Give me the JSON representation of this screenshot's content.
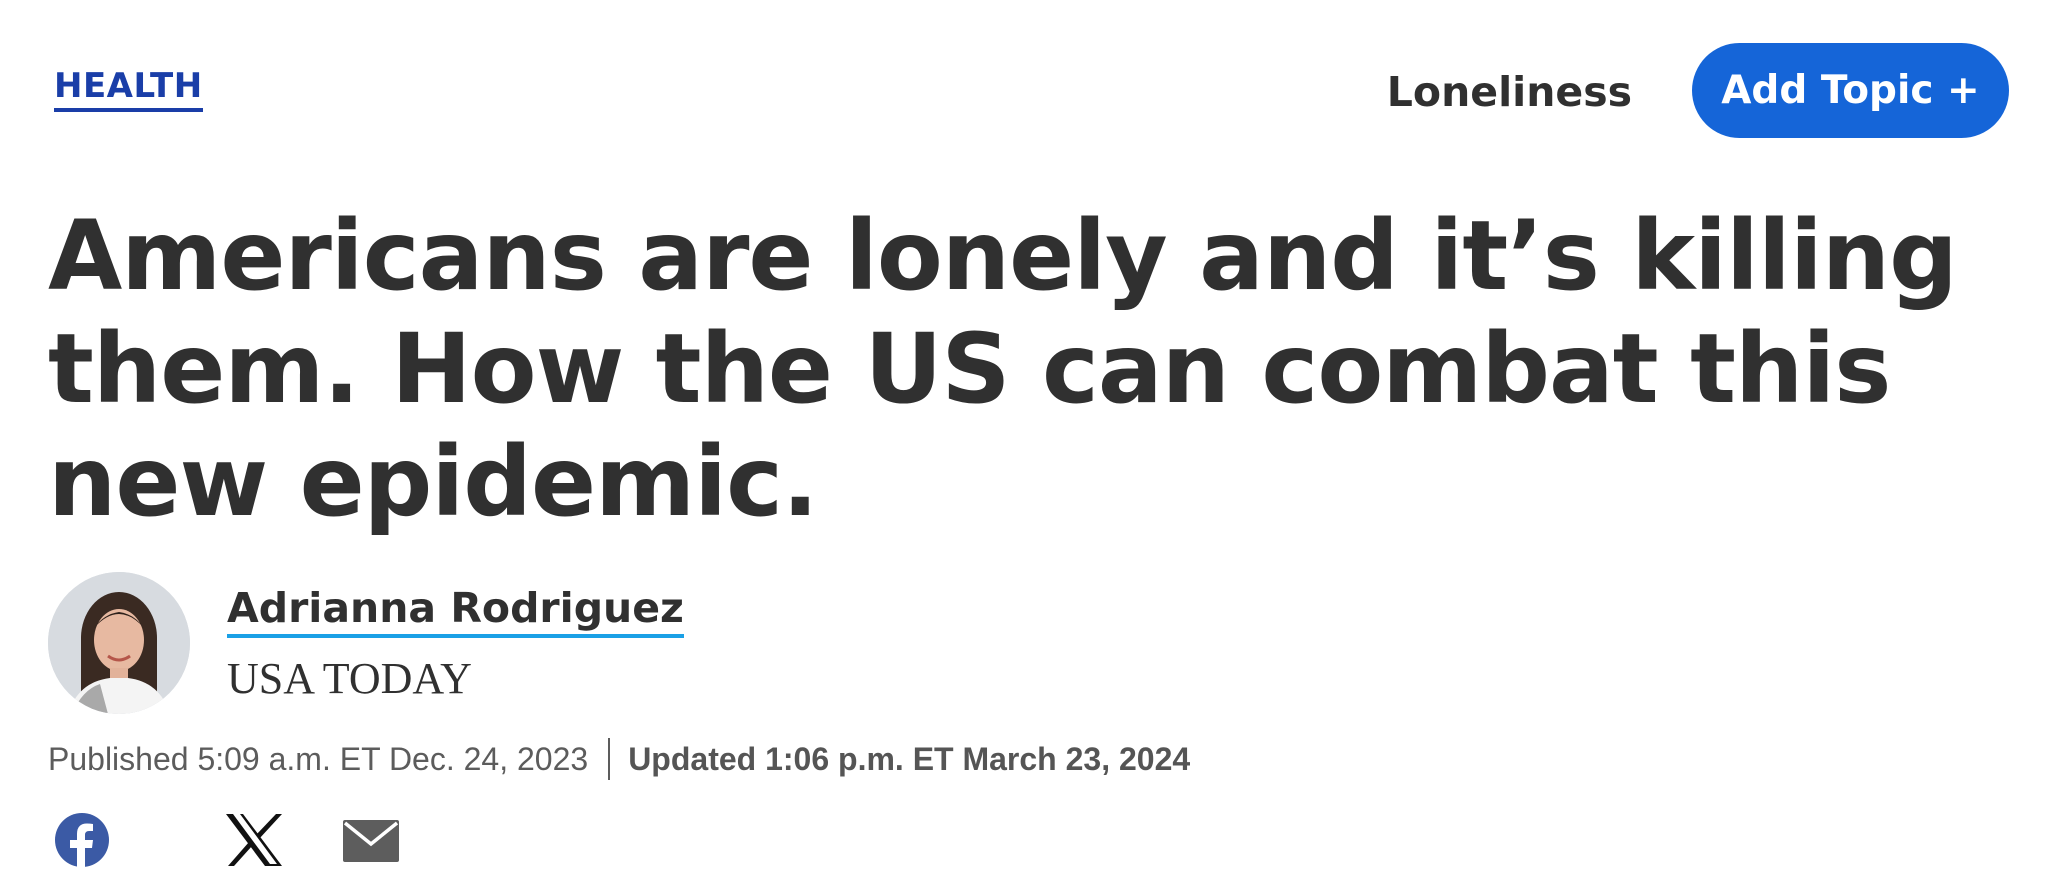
{
  "header": {
    "section_label": "HEALTH",
    "topic_label": "Loneliness",
    "add_topic_label": "Add Topic +"
  },
  "article": {
    "headline": "Americans are lonely and it’s killing them. How the US can combat this new epidemic.",
    "author": {
      "name": "Adrianna Rodriguez",
      "outlet": "USA TODAY"
    },
    "published": "Published 5:09 a.m. ET Dec. 24, 2023",
    "updated": "Updated 1:06 p.m. ET March 23, 2024"
  },
  "share": {
    "icons": [
      "facebook-icon",
      "x-icon",
      "email-icon"
    ]
  },
  "colors": {
    "section_link": "#1a3ea8",
    "add_topic_button": "#1565d8",
    "author_underline": "#1aa0e6",
    "facebook": "#3b5aa5",
    "text": "#303030"
  }
}
